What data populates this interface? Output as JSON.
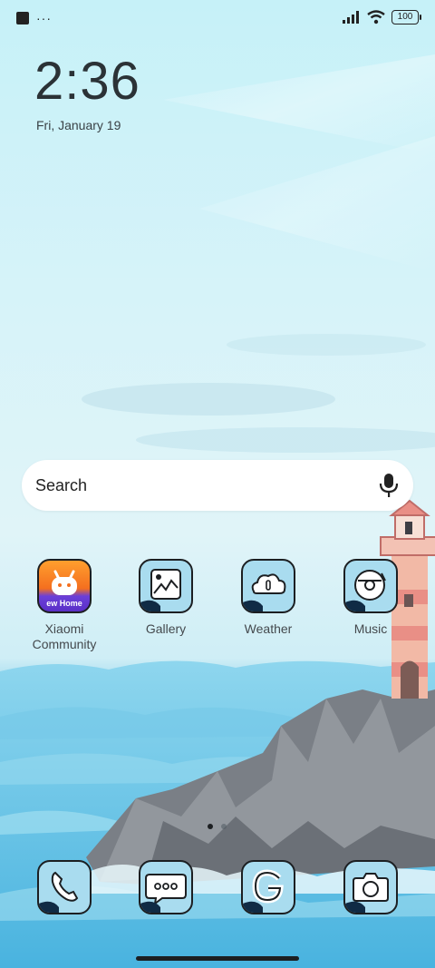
{
  "status_bar": {
    "left_icons": [
      "notification-square-icon",
      "more-dots-icon"
    ],
    "dots": "···",
    "battery": "100",
    "right_icons": [
      "signal-icon",
      "wifi-icon",
      "battery-icon"
    ]
  },
  "lockclock": {
    "time": "2:36",
    "date": "Fri, January 19"
  },
  "search": {
    "label": "Search",
    "icon": "mic-icon"
  },
  "apps": [
    {
      "label": "Xiaomi\nCommunity",
      "badge": "ew Home",
      "icon": "xiaomi-community-icon"
    },
    {
      "label": "Gallery",
      "icon": "gallery-icon"
    },
    {
      "label": "Weather",
      "icon": "weather-icon"
    },
    {
      "label": "Music",
      "icon": "music-icon"
    }
  ],
  "dock": [
    {
      "icon": "phone-icon"
    },
    {
      "icon": "messages-icon"
    },
    {
      "icon": "google-icon"
    },
    {
      "icon": "camera-icon"
    }
  ],
  "page_indicator": {
    "pages": 2,
    "current": 1
  }
}
